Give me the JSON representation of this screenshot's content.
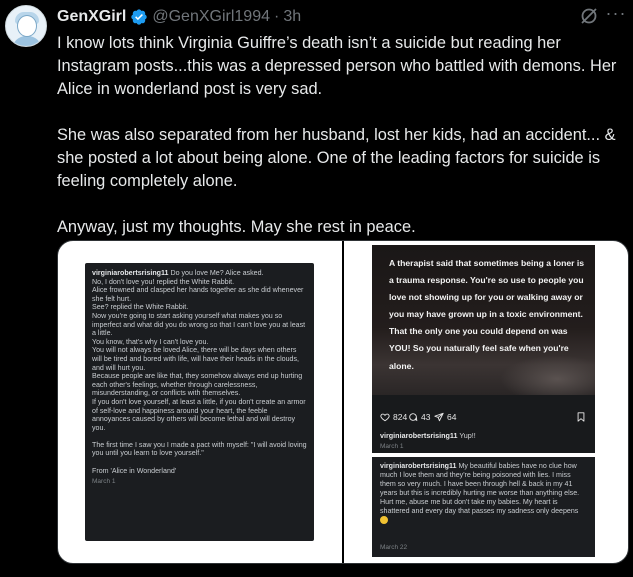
{
  "author": {
    "name": "GenXGirl",
    "handle": "@GenXGirl1994",
    "separator": "·",
    "time": "3h",
    "verified": true,
    "verified_color": "#1d9bf0"
  },
  "actions": {
    "grok_icon": "grok-icon",
    "more_icon": "more-icon",
    "more_label": "···"
  },
  "tweet": {
    "paragraphs": [
      "I know lots think Virginia Guiffre’s death isn’t a suicide but reading her Instagram posts...this was a depressed person who battled with demons. Her Alice in wonderland post is very sad.",
      "She was also separated from her husband, lost her kids, had an accident... & she posted a lot about being alone. One of the leading factors for suicide is feeling completely alone.",
      "Anyway, just my thoughts. May she rest in peace."
    ]
  },
  "media": {
    "left_post": {
      "username": "virginiarobertsrising11",
      "body": " Do you love Me? Alice asked.\nNo, I don't love you! replied the White Rabbit.\nAlice frowned and clasped her hands together as she did whenever she felt hurt.\nSee? replied the White Rabbit.\nNow you're going to start asking yourself what makes you so imperfect and what did you do wrong so that I can't love you at least a little.\nYou know, that's why I can't love you.\nYou will not always be loved Alice, there will be days when others will be tired and bored with life, will have their heads in the clouds, and will hurt you.\nBecause people are like that, they somehow always end up hurting each other's feelings, whether through carelessness, misunderstanding, or conflicts with themselves.\nIf you don't love yourself, at least a little, if you don't create an armor of self-love and happiness around your heart, the feeble annoyances caused by others will become lethal and will destroy you.\n\nThe first time I saw you I made a pact with myself: \"I will avoid loving you until you learn to love yourself.\"\n\nFrom 'Alice in Wonderland'",
      "date": "March 1"
    },
    "right_top_post": {
      "quote": "A therapist said that sometimes being a loner is a trauma response. You're so use to people you love not showing up for you or walking away or you may have grown up in a toxic environment. That the only one you could depend on was YOU! So you naturally feel safe when you're alone.",
      "likes": "824",
      "comments": "43",
      "shares": "64",
      "like_icon": "heart-icon",
      "comment_icon": "comment-icon",
      "share_icon": "send-icon",
      "save_icon": "bookmark-icon",
      "caption_user": "virginiarobertsrising11",
      "caption_text": " Yup!!",
      "date": "March 1"
    },
    "right_bottom_post": {
      "username": "virginiarobertsrising11",
      "body": " My beautiful babies have no clue how much I love them and they're being poisoned with lies. I miss them so very much. I have been through hell & back in my 41 years but this is incredibly hurting me worse than anything else. Hurt me, abuse me but don't take my babies. My heart is shattered and every day that passes my sadness only deepens ",
      "emoji_icon": "sad-face-emoji",
      "date": "March 22"
    }
  }
}
